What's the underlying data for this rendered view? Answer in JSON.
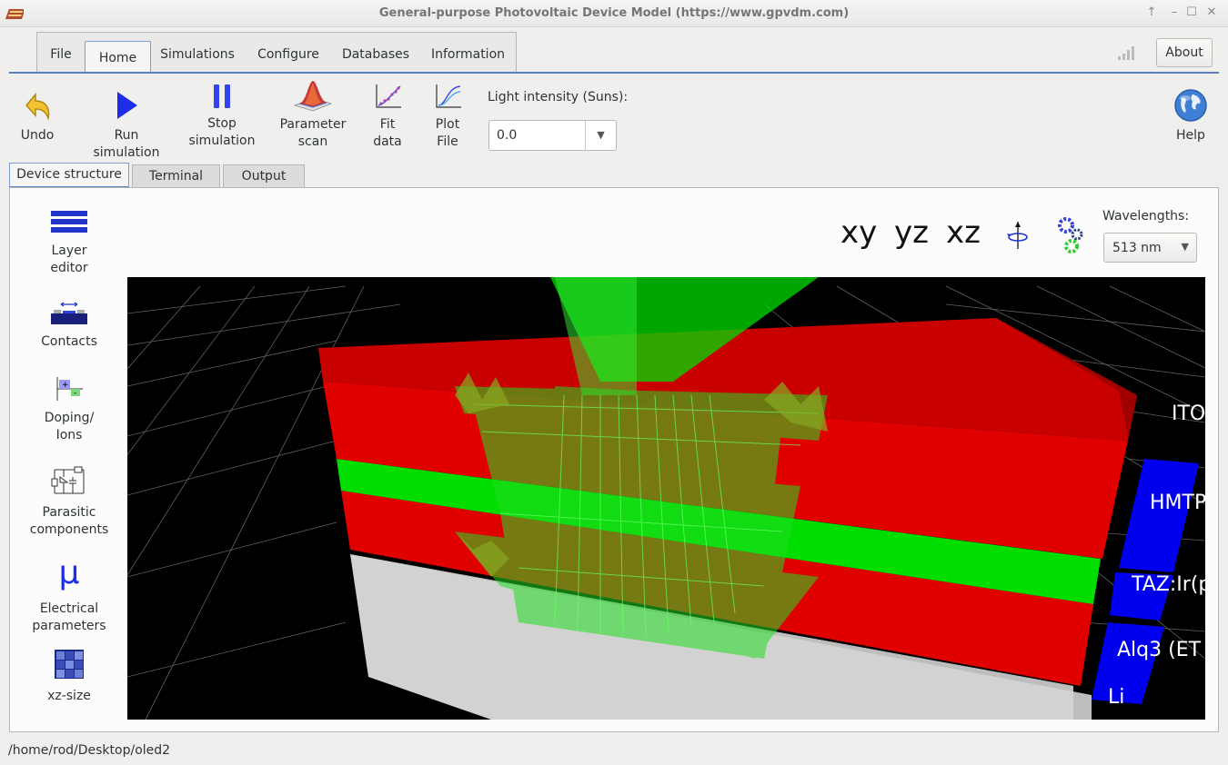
{
  "window": {
    "title": "General-purpose Photovoltaic Device Model (https://www.gpvdm.com)",
    "controls": [
      "↑",
      "–",
      "☐",
      "✕"
    ]
  },
  "menu_tabs": [
    {
      "label": "File"
    },
    {
      "label": "Home"
    },
    {
      "label": "Simulations"
    },
    {
      "label": "Configure"
    },
    {
      "label": "Databases"
    },
    {
      "label": "Information"
    }
  ],
  "about_label": "About",
  "toolbar": {
    "undo": "Undo",
    "run": "Run simulation",
    "stop_line1": "Stop",
    "stop_line2": "simulation",
    "scan_line1": "Parameter",
    "scan_line2": "scan",
    "fit_line1": "Fit",
    "fit_line2": "data",
    "plot_line1": "Plot",
    "plot_line2": "File",
    "light_label": "Light intensity (Suns):",
    "light_value": "0.0",
    "help": "Help"
  },
  "sub_tabs": [
    {
      "label": "Device structure"
    },
    {
      "label": "Terminal"
    },
    {
      "label": "Output"
    }
  ],
  "sidebar": [
    {
      "line1": "Layer",
      "line2": "editor"
    },
    {
      "line1": "Contacts",
      "line2": ""
    },
    {
      "line1": "Doping/",
      "line2": "Ions"
    },
    {
      "line1": "Parasitic",
      "line2": "components"
    },
    {
      "line1": "Electrical",
      "line2": "parameters"
    },
    {
      "line1": "xz-size",
      "line2": ""
    }
  ],
  "mu_symbol": "μ",
  "view": {
    "xy": "xy",
    "yz": "yz",
    "xz": "xz",
    "wavelength_label": "Wavelengths:",
    "wavelength_value": "513 nm"
  },
  "layers": [
    "ITO",
    "HMTP",
    "TAZ:Ir(p",
    "Alq3 (ET",
    "Li"
  ],
  "status": "/home/rod/Desktop/oled2",
  "colors": {
    "layer_red": "#e00000",
    "layer_green": "#00dd00",
    "label_blue": "#0000ee",
    "substrate": "#d2d2d2",
    "accent": "#5b7fbf"
  }
}
